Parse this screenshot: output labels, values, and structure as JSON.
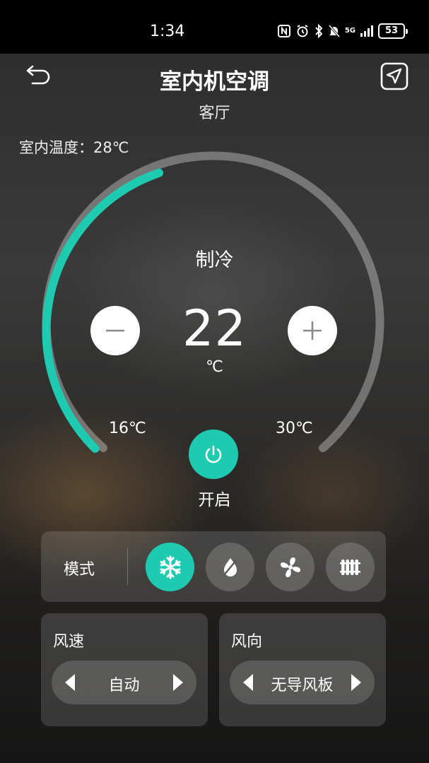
{
  "status_bar": {
    "time": "1:34",
    "network": "5G",
    "battery": "53"
  },
  "header": {
    "title": "室内机空调",
    "subtitle": "客厅"
  },
  "indoor": {
    "text": "室内温度：28℃"
  },
  "dial": {
    "mode": "制冷",
    "setpoint": "22",
    "unit": "℃",
    "min_label": "16℃",
    "max_label": "30℃",
    "range_fraction": 0.43,
    "accent": "#1ecbb0"
  },
  "power": {
    "label": "开启",
    "on": true
  },
  "modes": {
    "label": "模式",
    "items": [
      {
        "icon": "snowflake-icon",
        "active": true
      },
      {
        "icon": "dehumidify-icon",
        "active": false
      },
      {
        "icon": "fan-icon",
        "active": false
      },
      {
        "icon": "heater-icon",
        "active": false
      }
    ]
  },
  "wind_speed": {
    "title": "风速",
    "value": "自动"
  },
  "wind_direction": {
    "title": "风向",
    "value": "无导风板"
  }
}
